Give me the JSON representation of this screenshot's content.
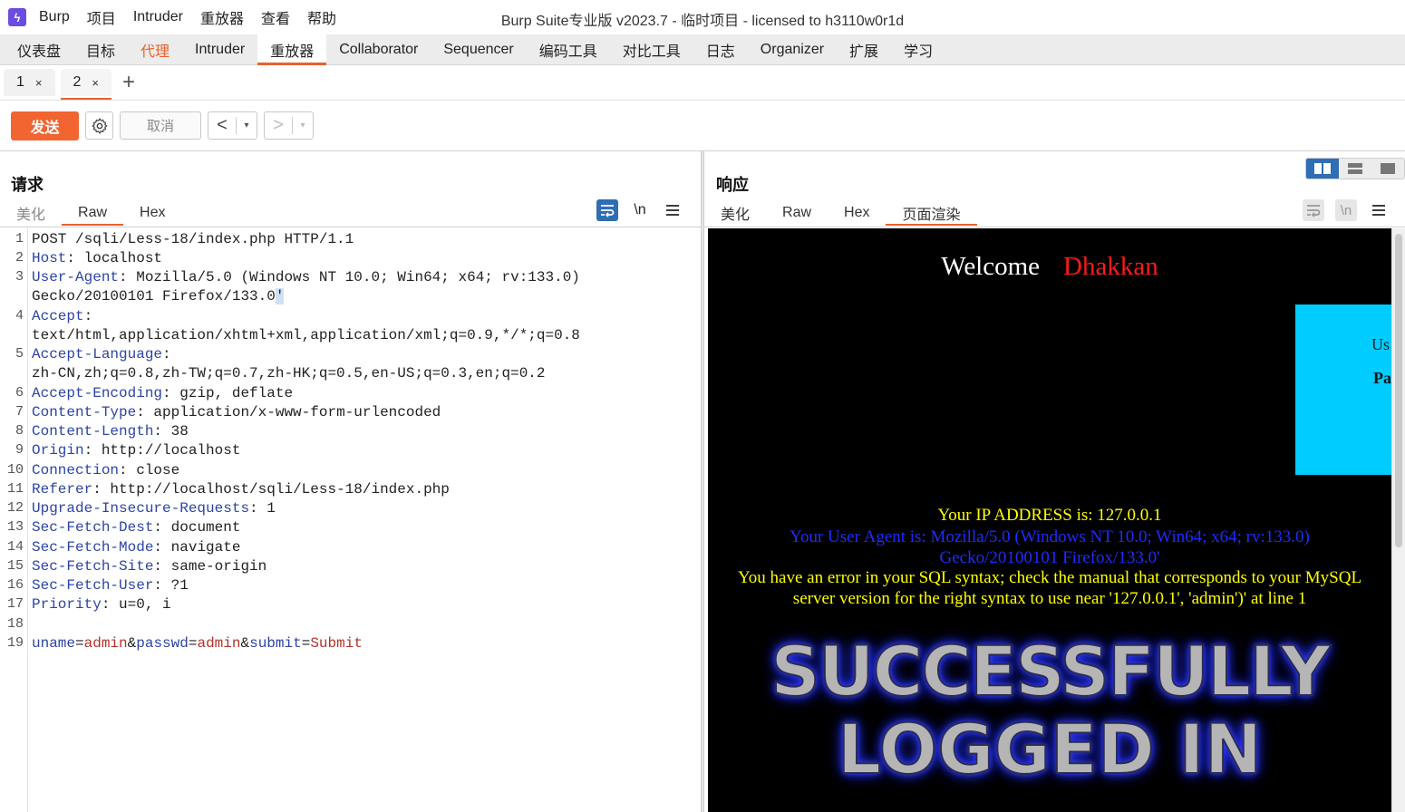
{
  "menubar": {
    "app_name": "Burp",
    "items": [
      "项目",
      "Intruder",
      "重放器",
      "查看",
      "帮助"
    ],
    "window_title": "Burp Suite专业版  v2023.7 - 临时项目 - licensed to h3110w0r1d"
  },
  "main_tabs": [
    "仪表盘",
    "目标",
    "代理",
    "Intruder",
    "重放器",
    "Collaborator",
    "Sequencer",
    "编码工具",
    "对比工具",
    "日志",
    "Organizer",
    "扩展",
    "学习"
  ],
  "active_main_tab": "重放器",
  "highlighted_main_tab": "代理",
  "repeater_tabs": [
    {
      "label": "1",
      "close": "×"
    },
    {
      "label": "2",
      "close": "×"
    }
  ],
  "add_tab_symbol": "+",
  "toolbar": {
    "send_label": "发送",
    "settings_icon": "gear-icon",
    "cancel_label": "取消",
    "back_symbol": "<",
    "forward_symbol": ">",
    "dropdown_symbol": "▾"
  },
  "request": {
    "title": "请求",
    "tabs": [
      "美化",
      "Raw",
      "Hex"
    ],
    "active_tab": "Raw",
    "newline_label": "\\n",
    "line_numbers": [
      "1",
      "2",
      "3",
      "4",
      "5",
      "6",
      "7",
      "8",
      "9",
      "10",
      "11",
      "12",
      "13",
      "14",
      "15",
      "16",
      "17",
      "18",
      "19"
    ],
    "lines": {
      "l1": "POST /sqli/Less-18/index.php HTTP/1.1",
      "l2k": "Host",
      "l2v": " localhost",
      "l3k": "User-Agent",
      "l3v": " Mozilla/5.0 (Windows NT 10.0; Win64; x64; rv:133.0)",
      "l3c": "Gecko/20100101 Firefox/133.0",
      "l3q": "'",
      "l4k": "Accept",
      "l4c": "text/html,application/xhtml+xml,application/xml;q=0.9,*/*;q=0.8",
      "l5k": "Accept-Language",
      "l5c": "zh-CN,zh;q=0.8,zh-TW;q=0.7,zh-HK;q=0.5,en-US;q=0.3,en;q=0.2",
      "l6k": "Accept-Encoding",
      "l6v": " gzip, deflate",
      "l7k": "Content-Type",
      "l7v": " application/x-www-form-urlencoded",
      "l8k": "Content-Length",
      "l8v": " 38",
      "l9k": "Origin",
      "l9v": " http://localhost",
      "l10k": "Connection",
      "l10v": " close",
      "l11k": "Referer",
      "l11v": " http://localhost/sqli/Less-18/index.php",
      "l12k": "Upgrade-Insecure-Requests",
      "l12v": " 1",
      "l13k": "Sec-Fetch-Dest",
      "l13v": " document",
      "l14k": "Sec-Fetch-Mode",
      "l14v": " navigate",
      "l15k": "Sec-Fetch-Site",
      "l15v": " same-origin",
      "l16k": "Sec-Fetch-User",
      "l16v": " ?1",
      "l17k": "Priority",
      "l17v": " u=0, i",
      "body": {
        "k1": "uname",
        "v1": "admin",
        "k2": "passwd",
        "v2": "admin",
        "k3": "submit",
        "v3": "Submit"
      }
    }
  },
  "response": {
    "title": "响应",
    "tabs": [
      "美化",
      "Raw",
      "Hex",
      "页面渲染"
    ],
    "active_tab": "页面渲染",
    "newline_label": "\\n",
    "rendered": {
      "welcome": "Welcome",
      "name": "Dhakkan",
      "form_user_fragment": "Us",
      "form_pass_fragment": "Pa",
      "ip_line": "Your IP ADDRESS is: 127.0.0.1",
      "ua_line1": "Your User Agent is: Mozilla/5.0 (Windows NT 10.0; Win64; x64; rv:133.0)",
      "ua_line2": "Gecko/20100101 Firefox/133.0'",
      "error_line1": "You have an error in your SQL syntax; check the manual that corresponds to your MySQL",
      "error_line2": "server version for the right syntax to use near '127.0.0.1', 'admin')' at line 1",
      "success_line1": "SUCCESSFULLY",
      "success_line2": "LOGGED IN"
    }
  },
  "colors": {
    "accent": "#e8622c",
    "send_button": "#f26430",
    "header_key": "#2c44a6",
    "param_value": "#b4322a",
    "layout_active": "#2f6db5"
  }
}
